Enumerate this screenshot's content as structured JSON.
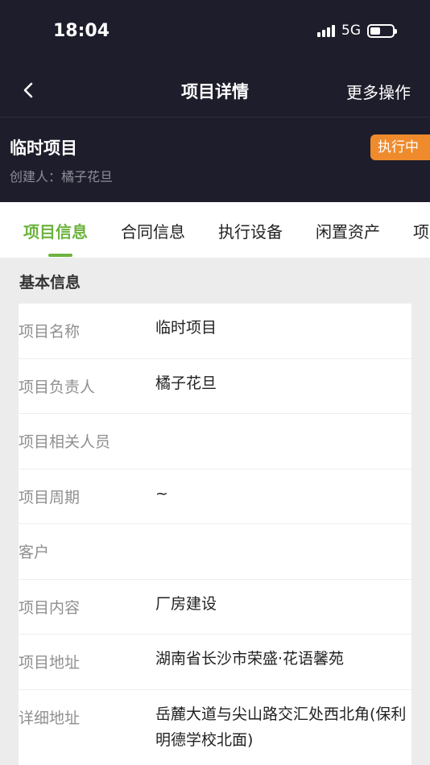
{
  "status_bar": {
    "time": "18:04",
    "network": "5G",
    "battery_level": 0.45
  },
  "nav": {
    "title": "项目详情",
    "more": "更多操作",
    "back_icon": "chevron-left-icon"
  },
  "project": {
    "name": "临时项目",
    "creator_label": "创建人：",
    "creator_name": "橘子花旦",
    "status": "执行中",
    "status_color": "#ef8b2c"
  },
  "tabs": [
    "项目信息",
    "合同信息",
    "执行设备",
    "闲置资产",
    "项"
  ],
  "active_tab_color": "#6db33f",
  "section": {
    "title": "基本信息"
  },
  "info_rows": [
    {
      "label": "项目名称",
      "value": "临时项目"
    },
    {
      "label": "项目负责人",
      "value": "橘子花旦"
    },
    {
      "label": "项目相关人员",
      "value": ""
    },
    {
      "label": "项目周期",
      "value": "~"
    },
    {
      "label": "客户",
      "value": ""
    },
    {
      "label": "项目内容",
      "value": "厂房建设"
    },
    {
      "label": "项目地址",
      "value": "湖南省长沙市荣盛·花语馨苑"
    },
    {
      "label": "详细地址",
      "value": "岳麓大道与尖山路交汇处西北角(保利明德学校北面)"
    }
  ]
}
